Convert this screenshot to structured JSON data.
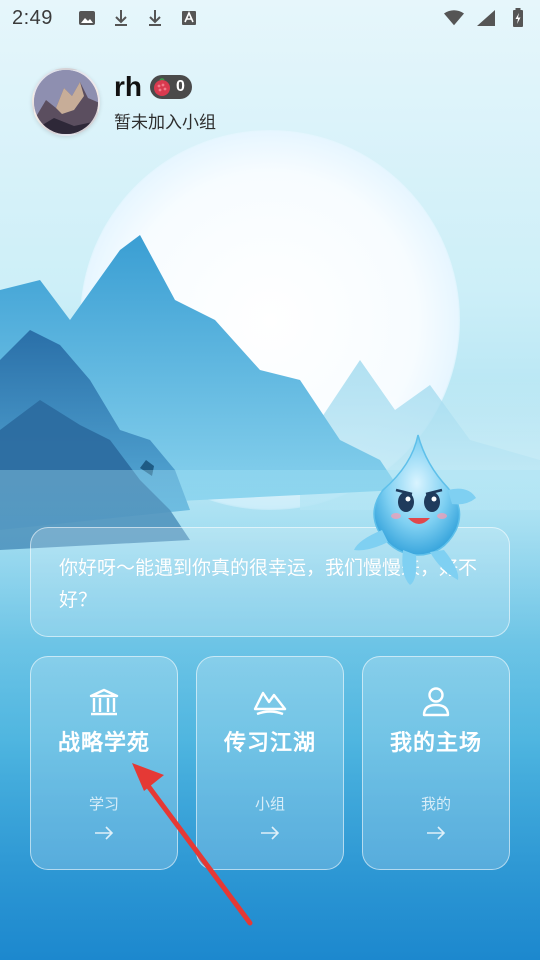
{
  "status_bar": {
    "time": "2:49",
    "icons": [
      "image-icon",
      "download-icon",
      "download-icon",
      "font-icon"
    ],
    "right_icons": [
      "wifi-icon",
      "signal-icon",
      "battery-charging-icon"
    ]
  },
  "profile": {
    "username": "rh",
    "badge_count": "0",
    "group_status": "暂未加入小组"
  },
  "greeting": {
    "text": "你好呀～能遇到你真的很幸运，我们慢慢来，好不好？"
  },
  "cards": [
    {
      "title": "战略学苑",
      "sub": "学习",
      "icon": "bank-icon"
    },
    {
      "title": "传习江湖",
      "sub": "小组",
      "icon": "mountain-icon"
    },
    {
      "title": "我的主场",
      "sub": "我的",
      "icon": "user-icon"
    }
  ],
  "colors": {
    "accent_white": "#ffffff",
    "badge_bg": "#4a4a4a",
    "pointer_red": "#e53935"
  }
}
